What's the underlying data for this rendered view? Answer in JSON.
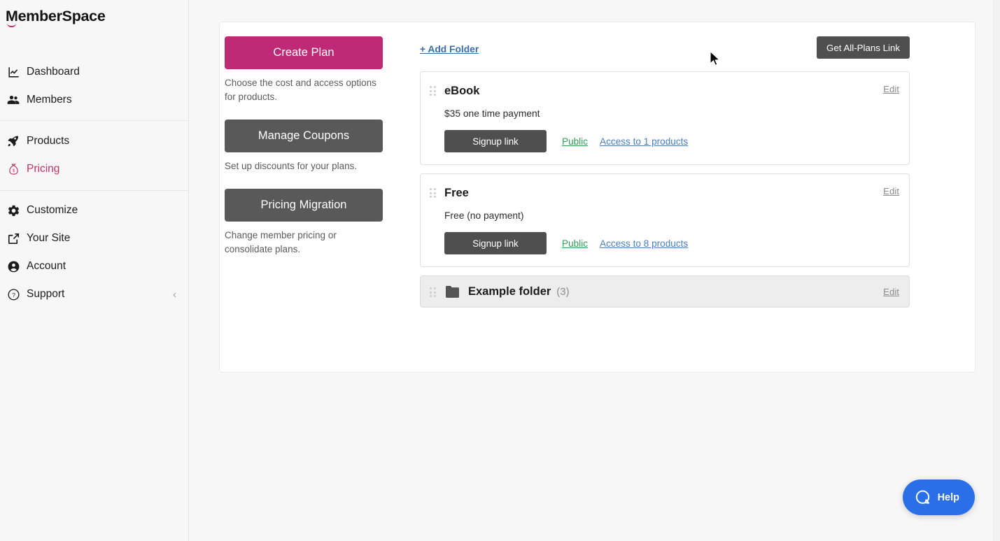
{
  "brand": {
    "name": "MemberSpace",
    "accent": "#bf2a76",
    "link_blue": "#4a7dbd",
    "green": "#2f9e55"
  },
  "sidebar": {
    "items": [
      {
        "label": "Dashboard",
        "icon": "chart-line-icon",
        "active": false
      },
      {
        "label": "Members",
        "icon": "people-icon",
        "active": false
      },
      {
        "label": "Products",
        "icon": "rocket-icon",
        "active": false
      },
      {
        "label": "Pricing",
        "icon": "money-bag-icon",
        "active": true
      },
      {
        "label": "Customize",
        "icon": "gear-icon",
        "active": false
      },
      {
        "label": "Your Site",
        "icon": "external-link-icon",
        "active": false
      },
      {
        "label": "Account",
        "icon": "user-circle-icon",
        "active": false
      },
      {
        "label": "Support",
        "icon": "question-circle-icon",
        "active": false
      }
    ],
    "collapse_chevron": "‹"
  },
  "actions": [
    {
      "label": "Create Plan",
      "style": "primary",
      "description": "Choose the cost and access options for products."
    },
    {
      "label": "Manage Coupons",
      "style": "secondary",
      "description": "Set up discounts for your plans."
    },
    {
      "label": "Pricing Migration",
      "style": "secondary",
      "description": "Change member pricing or consolidate plans."
    }
  ],
  "plans_header": {
    "add_folder_label": "+ Add Folder",
    "get_all_plans_label": "Get All-Plans Link"
  },
  "plans": [
    {
      "title": "eBook",
      "price": "$35 one time payment",
      "signup_label": "Signup link",
      "visibility": "Public",
      "access": "Access to 1 products",
      "edit_label": "Edit"
    },
    {
      "title": "Free",
      "price": "Free (no payment)",
      "signup_label": "Signup link",
      "visibility": "Public",
      "access": "Access to 8 products",
      "edit_label": "Edit"
    }
  ],
  "folder": {
    "name": "Example folder",
    "count": "(3)",
    "edit_label": "Edit",
    "icon": "folder-icon"
  },
  "help_widget": {
    "label": "Help",
    "icon": "chat-bubble-icon"
  }
}
